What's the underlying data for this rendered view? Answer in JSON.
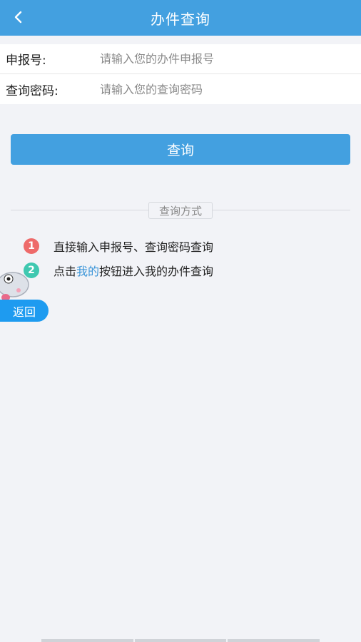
{
  "header": {
    "title": "办件查询",
    "back_icon": "chevron-left-icon"
  },
  "form": {
    "fields": [
      {
        "label": "申报号:",
        "placeholder": "请输入您的办件申报号",
        "value": ""
      },
      {
        "label": "查询密码:",
        "placeholder": "请输入您的查询密码",
        "value": ""
      }
    ]
  },
  "actions": {
    "query_label": "查询"
  },
  "methods": {
    "title": "查询方式",
    "items": [
      {
        "num": "1",
        "text": "直接输入申报号、查询密码查询"
      },
      {
        "num": "2",
        "prefix": "点击",
        "link": "我的",
        "suffix": "按钮进入我的办件查询"
      }
    ]
  },
  "floating": {
    "return_label": "返回"
  },
  "colors": {
    "accent": "#43a0e0",
    "badge1": "#ee6a6a",
    "badge2": "#3fc8b0",
    "link": "#3a95d8"
  }
}
